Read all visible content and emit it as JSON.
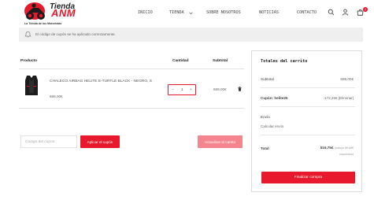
{
  "brand": {
    "name_line1": "Tienda",
    "name_line2": "ANM",
    "tagline": "La Tienda de los Motoristas",
    "accent_color": "#e8192c"
  },
  "nav": {
    "items": [
      {
        "label": "INICIO"
      },
      {
        "label": "TIENDA"
      },
      {
        "label": "SOBRE NOSOTROS"
      },
      {
        "label": "NOTICIAS"
      },
      {
        "label": "CONTACTO"
      }
    ],
    "icons": [
      "search-icon",
      "user-icon",
      "cart-icon"
    ],
    "cart_count": "2"
  },
  "notice": {
    "icon": "bell-icon",
    "text": "El código de cupón se ha aplicado correctamente."
  },
  "cart": {
    "headers": {
      "product": "Producto",
      "quantity": "Cantidad",
      "subtotal": "Subtotal"
    },
    "items": [
      {
        "name": "CHALECO AIRBAG HELITE E-TURTLE BLACK - NEGRO, S",
        "price": "689,00€",
        "quantity": "1",
        "subtotal": "689,00€"
      }
    ],
    "coupon_placeholder": "Código del cupón",
    "apply_label": "Aplicar el cupón",
    "update_label": "Actualizar el carrito"
  },
  "totals": {
    "title": "Totales del carrito",
    "subtotal_label": "Subtotal",
    "subtotal_value": "689,00€",
    "coupon_label": "Cupón: helite25",
    "coupon_value": "-172,25€ [Eliminar]",
    "shipping_label": "Envío",
    "shipping_link": "Calcular envío",
    "total_label": "Total",
    "total_value": "516,75€",
    "total_note_line1": "(incluye 89,68€",
    "total_note_line2": "impuestos)",
    "checkout_label": "Finalizar compra"
  }
}
